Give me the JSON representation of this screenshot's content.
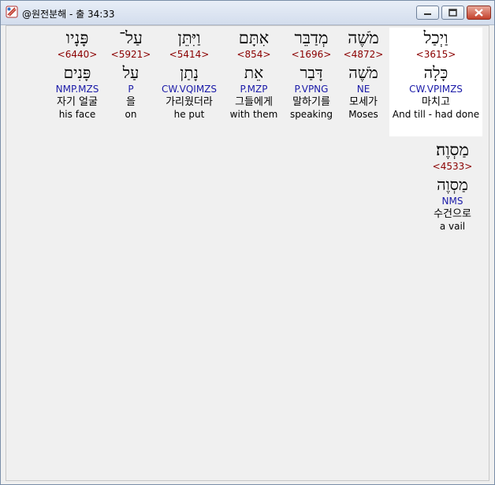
{
  "window": {
    "title": "@원전분해 - 출 34:33"
  },
  "words": [
    {
      "hebrew": "וַיְכַל",
      "strong": "<3615>",
      "root": "כָּלָה",
      "morph": "CW.VPIMZS",
      "korean": "마치고",
      "english": "And till - had done",
      "selected": true
    },
    {
      "hebrew": "מֹשֶׁה",
      "strong": "<4872>",
      "root": "מֹשֶׁה",
      "morph": "NE",
      "korean": "모세가",
      "english": "Moses",
      "selected": false
    },
    {
      "hebrew": "מְדַבֵּר",
      "strong": "<1696>",
      "root": "דָּבַר",
      "morph": "P.VPNG",
      "korean": "말하기를",
      "english": "speaking",
      "selected": false
    },
    {
      "hebrew": "אִתָּם",
      "strong": "<854>",
      "root": "אֵת",
      "morph": "P.MZP",
      "korean": "그들에게",
      "english": "with them",
      "selected": false
    },
    {
      "hebrew": "וַיִּתֵּן",
      "strong": "<5414>",
      "root": "נָתַן",
      "morph": "CW.VQIMZS",
      "korean": "가리웠더라",
      "english": "he put",
      "selected": false
    },
    {
      "hebrew": "עַל־",
      "strong": "<5921>",
      "root": "עַל",
      "morph": "P",
      "korean": "을",
      "english": "on",
      "selected": false
    },
    {
      "hebrew": "פָּנָיו",
      "strong": "<6440>",
      "root": "פָּנִים",
      "morph": "NMP.MZS",
      "korean": "자기 얼굴",
      "english": "his face",
      "selected": false
    },
    {
      "hebrew": "מַסְוֶה׃",
      "strong": "<4533>",
      "root": "מַסְוֶה",
      "morph": "NMS",
      "korean": "수건으로",
      "english": "a vail",
      "selected": false
    }
  ]
}
